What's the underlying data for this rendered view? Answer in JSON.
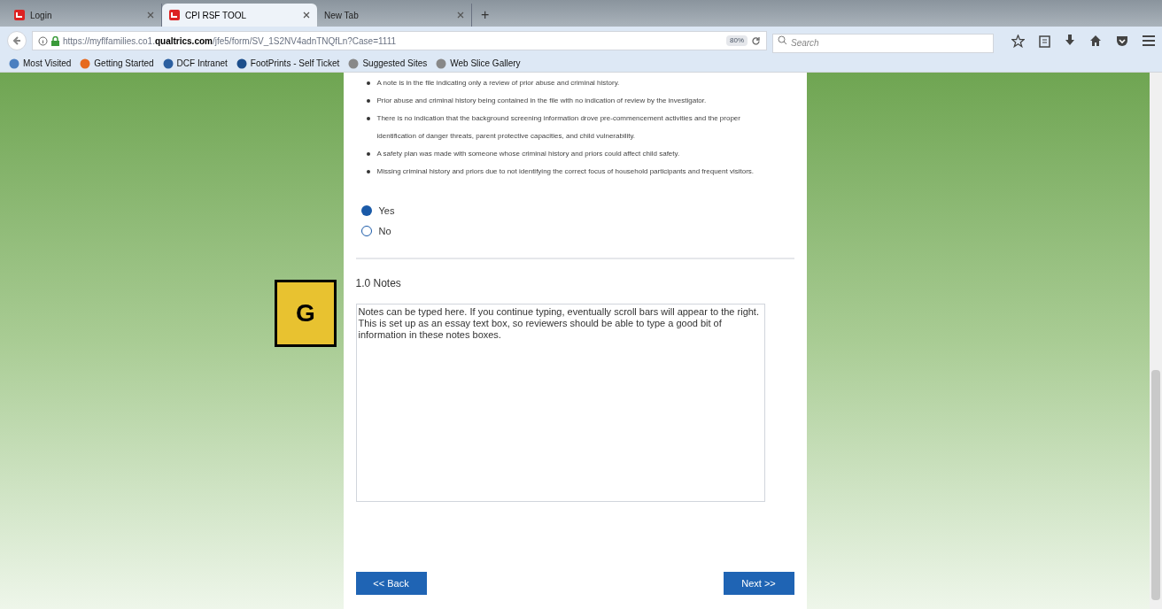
{
  "browser": {
    "tabs": [
      {
        "label": "Login",
        "selected": false
      },
      {
        "label": "CPI RSF TOOL",
        "selected": true
      },
      {
        "label": "New Tab",
        "selected": false
      }
    ],
    "new_tab": "+",
    "url": {
      "prefix": "https://myflfamilies.co1.",
      "domain": "qualtrics.com",
      "path": "/jfe5/form/SV_1S2NV4adnTNQfLn?Case=1111"
    },
    "zoom": "80%",
    "search": {
      "placeholder": "Search"
    },
    "bookmarks": [
      "Most Visited",
      "Getting Started",
      "DCF Intranet",
      "FootPrints - Self Ticket",
      "Suggested Sites",
      "Web Slice Gallery"
    ]
  },
  "question": {
    "bullets": [
      "A note is in the file indicating only a review of prior abuse and criminal history.",
      "Prior abuse and criminal history being contained in the file with no indication of review by the investigator.",
      "There is no indication that the background screening information drove pre-commencement activities and the proper identification of danger threats, parent protective capacities, and child vulnerability.",
      "A safety plan was made with someone whose criminal history and priors could affect child safety.",
      "Missing criminal history and priors due to not identifying the correct focus of household participants and frequent visitors."
    ],
    "options": [
      {
        "label": "Yes",
        "selected": true
      },
      {
        "label": "No",
        "selected": false
      }
    ]
  },
  "notes": {
    "title": "1.0 Notes",
    "value": "Notes can be typed here. If you continue typing, eventually scroll bars will appear to the right. This is set up as an essay text box, so reviewers should be able to type a good bit of information in these notes boxes."
  },
  "callout": "G",
  "buttons": {
    "back": "<< Back",
    "next": "Next >>"
  }
}
